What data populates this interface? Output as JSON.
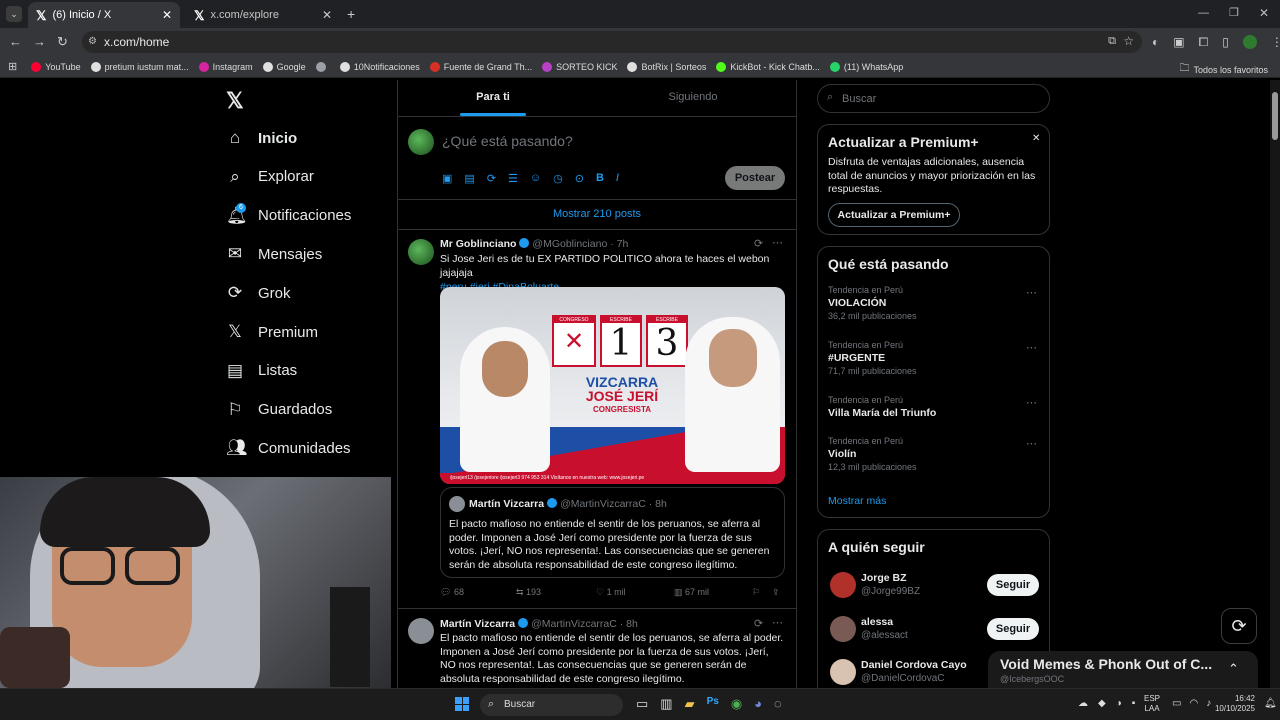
{
  "browser": {
    "tabs": [
      {
        "title": "(6) Inicio / X"
      },
      {
        "title": "x.com/explore"
      }
    ],
    "url": "x.com/home",
    "bookmarks": [
      {
        "label": "YouTube",
        "color": "#ff0033"
      },
      {
        "label": "pretium iustum mat...",
        "color": "#e0e0e0"
      },
      {
        "label": "Instagram",
        "color": "#d6249f"
      },
      {
        "label": "Google",
        "color": "#e0e0e0"
      },
      {
        "label": "",
        "color": "#9aa0a6"
      },
      {
        "label": "10Notificaciones",
        "color": "#e0e0e0"
      },
      {
        "label": "Fuente de Grand Th...",
        "color": "#d93025"
      },
      {
        "label": "SORTEO KICK",
        "color": "#b83fc7"
      },
      {
        "label": "BotRix | Sorteos",
        "color": "#e0e0e0"
      },
      {
        "label": "KickBot - Kick Chatb...",
        "color": "#53fc18"
      },
      {
        "label": "(11) WhatsApp",
        "color": "#25d366"
      }
    ],
    "all_bookmarks": "Todos los favoritos"
  },
  "nav": {
    "items": [
      {
        "label": "Inicio",
        "icon": "home-icon"
      },
      {
        "label": "Explorar",
        "icon": "search-icon"
      },
      {
        "label": "Notificaciones",
        "icon": "bell-icon",
        "badge": "6"
      },
      {
        "label": "Mensajes",
        "icon": "mail-icon"
      },
      {
        "label": "Grok",
        "icon": "grok-icon"
      },
      {
        "label": "Premium",
        "icon": "x-premium-icon"
      },
      {
        "label": "Listas",
        "icon": "list-icon"
      },
      {
        "label": "Guardados",
        "icon": "bookmark-icon"
      },
      {
        "label": "Comunidades",
        "icon": "communities-icon"
      }
    ]
  },
  "feed": {
    "tabs": [
      "Para ti",
      "Siguiendo"
    ],
    "composer_placeholder": "¿Qué está pasando?",
    "post_button": "Postear",
    "show_more_posts": "Mostrar 210 posts"
  },
  "tweet1": {
    "name": "Mr Goblinciano",
    "handle": "@MGoblinciano · 7h",
    "text": "Si Jose Jeri es de tu EX PARTIDO POLITICO ahora te haces el webon jajajaja",
    "hashtags": "#peru #jeri #DinaBoluarte",
    "image": {
      "label1": "CONGRESO",
      "label2": "ESCRIBE",
      "label3": "ESCRIBE",
      "n1": "1",
      "n2": "3",
      "line1": "VIZCARRA",
      "line2": "JOSÉ JERÍ",
      "line3": "CONGRESISTA",
      "footer": "/josejeri13   /josejeriore   /josejeri3   974 953 314   Visítanos en nuestra web: www.josejeri.pe"
    },
    "quote": {
      "name": "Martín Vizcarra",
      "handle": "@MartinVizcarraC · 8h",
      "text": "El pacto mafioso no entiende el sentir de los peruanos, se aferra al poder. Imponen a José Jerí como presidente por la fuerza de sus votos. ¡Jerí, NO nos representa!. Las consecuencias que se generen serán de absoluta responsabilidad de este congreso ilegítimo."
    },
    "replies": "68",
    "retweets": "193",
    "likes": "1 mil",
    "views": "67 mil"
  },
  "tweet2": {
    "name": "Martín Vizcarra",
    "handle": "@MartinVizcarraC · 8h",
    "text": "El pacto mafioso no entiende el sentir de los peruanos, se aferra al poder. Imponen a José Jerí como presidente por la fuerza de sus votos. ¡Jerí, NO nos representa!. Las consecuencias que se generen serán de absoluta responsabilidad de este congreso ilegítimo."
  },
  "sidebar": {
    "search_placeholder": "Buscar",
    "premium": {
      "title": "Actualizar a Premium+",
      "body": "Disfruta de ventajas adicionales, ausencia total de anuncios y mayor priorización en las respuestas.",
      "button": "Actualizar a Premium+"
    },
    "trends_title": "Qué está pasando",
    "trends": [
      {
        "context": "Tendencia en Perú",
        "name": "VIOLACIÓN",
        "count": "36,2 mil publicaciones"
      },
      {
        "context": "Tendencia en Perú",
        "name": "#URGENTE",
        "count": "71,7 mil publicaciones"
      },
      {
        "context": "Tendencia en Perú",
        "name": "Villa María del Triunfo",
        "count": ""
      },
      {
        "context": "Tendencia en Perú",
        "name": "Violín",
        "count": "12,3 mil publicaciones"
      }
    ],
    "show_more": "Mostrar más",
    "follow_title": "A quién seguir",
    "follow": [
      {
        "name": "Jorge BZ",
        "handle": "@Jorge99BZ",
        "button": "Seguir"
      },
      {
        "name": "alessa",
        "handle": "@alessact",
        "button": "Seguir"
      },
      {
        "name": "Daniel Cordova Cayo",
        "handle": "@DanielCordovaC",
        "button": ""
      }
    ]
  },
  "space": {
    "title": "Void Memes & Phonk Out of C...",
    "host": "@IcebergsOOC"
  },
  "taskbar": {
    "search": "Buscar",
    "lang1": "ESP",
    "lang2": "LAA",
    "time": "16:42",
    "date": "10/10/2025"
  }
}
